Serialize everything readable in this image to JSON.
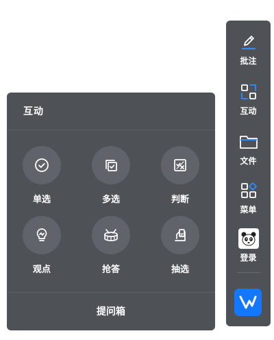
{
  "colors": {
    "panel_bg": "#4e5257",
    "circle_bg": "#60646a",
    "accent_blue": "#2f8cff",
    "brand_blue": "#1478ff"
  },
  "panel": {
    "title": "互动",
    "tools": [
      {
        "label": "单选",
        "icon": "check-circle-icon"
      },
      {
        "label": "多选",
        "icon": "multi-check-icon"
      },
      {
        "label": "判断",
        "icon": "true-false-icon"
      },
      {
        "label": "观点",
        "icon": "lightbulb-icon"
      },
      {
        "label": "抢答",
        "icon": "drum-icon"
      },
      {
        "label": "抽选",
        "icon": "random-pick-icon"
      }
    ],
    "footer": "提问箱"
  },
  "toolbar": {
    "items": [
      {
        "label": "批注",
        "icon": "pen-icon"
      },
      {
        "label": "互动",
        "icon": "interaction-icon"
      },
      {
        "label": "文件",
        "icon": "folder-icon"
      },
      {
        "label": "菜单",
        "icon": "menu-grid-icon"
      },
      {
        "label": "登录",
        "icon": "panda-avatar-icon"
      }
    ],
    "brand_icon": "brand-logo-icon"
  }
}
